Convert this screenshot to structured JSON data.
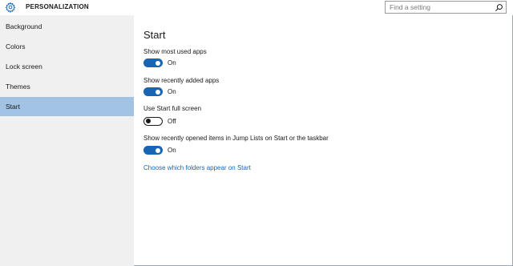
{
  "header": {
    "title": "PERSONALIZATION",
    "search_placeholder": "Find a setting",
    "icon": "gear-icon"
  },
  "sidebar": {
    "items": [
      {
        "label": "Background"
      },
      {
        "label": "Colors"
      },
      {
        "label": "Lock screen"
      },
      {
        "label": "Themes"
      },
      {
        "label": "Start",
        "selected": true
      }
    ]
  },
  "main": {
    "title": "Start",
    "settings": [
      {
        "label": "Show most used apps",
        "state": "On",
        "on": true
      },
      {
        "label": "Show recently added apps",
        "state": "On",
        "on": true
      },
      {
        "label": "Use Start full screen",
        "state": "Off",
        "on": false
      },
      {
        "label": "Show recently opened items in Jump Lists on Start or the taskbar",
        "state": "On",
        "on": true
      }
    ],
    "link": "Choose which folders appear on Start"
  },
  "colors": {
    "accent": "#1a64b4",
    "selected_nav": "#a2c3e3",
    "sidebar_bg": "#f0f0f0"
  }
}
